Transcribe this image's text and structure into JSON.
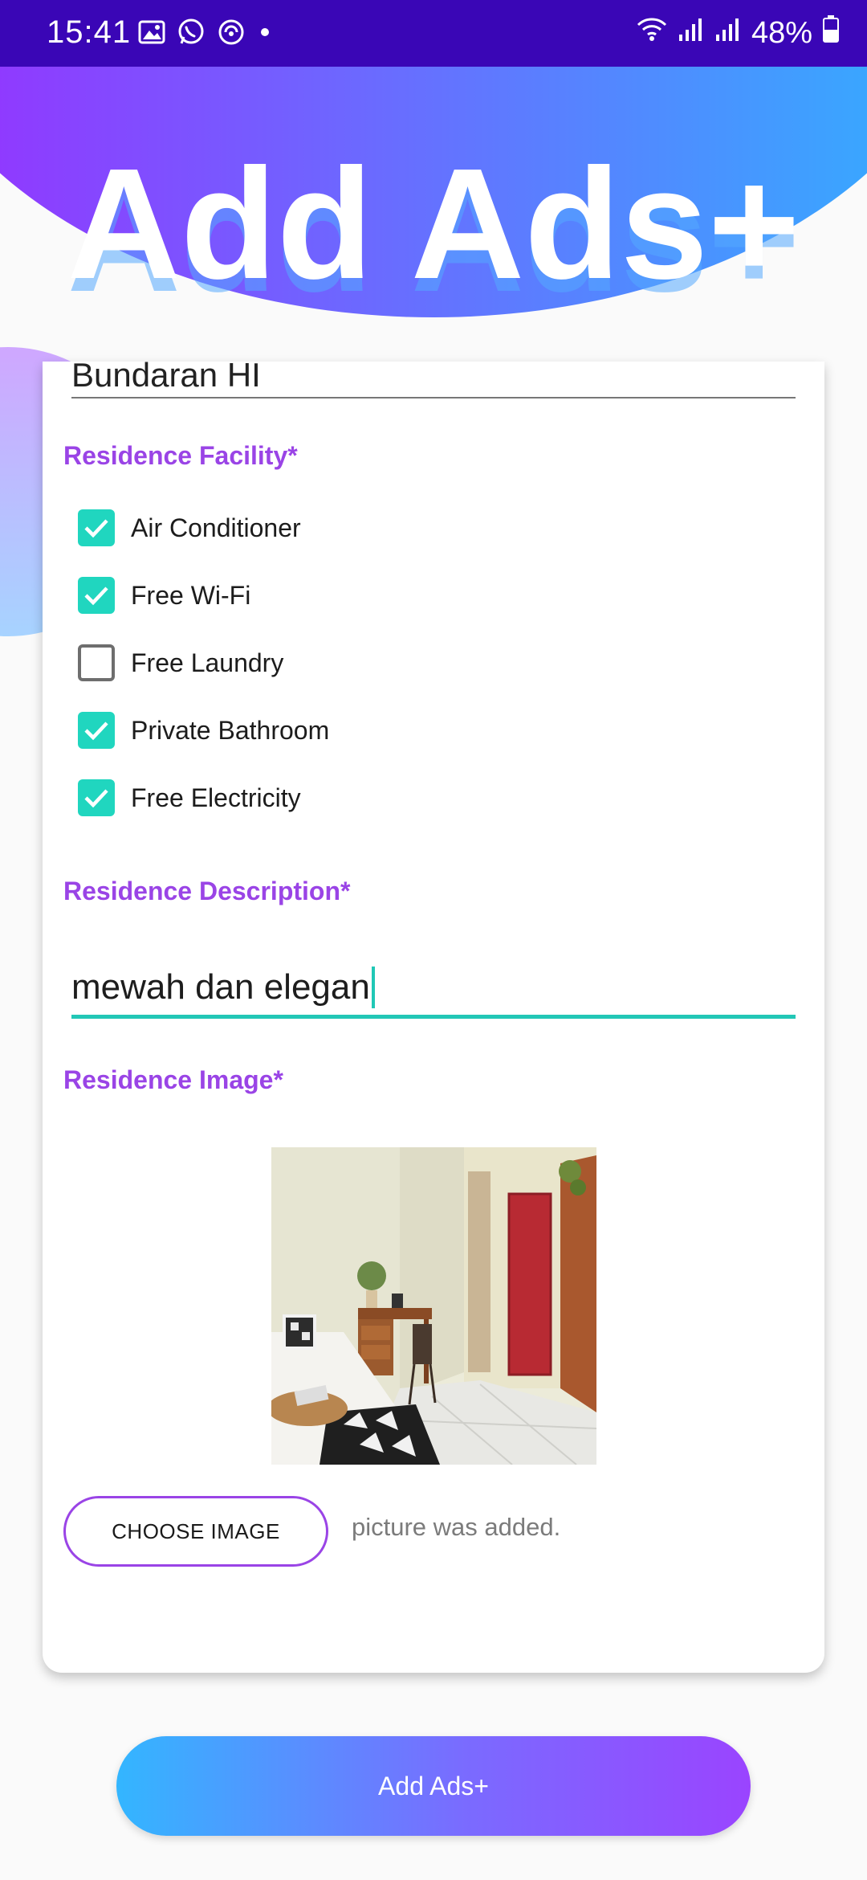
{
  "status_bar": {
    "time": "15:41",
    "battery": "48%",
    "left_icons": [
      "gallery-icon",
      "whatsapp-icon",
      "sync-icon",
      "dot-icon"
    ],
    "right_icons": [
      "wifi-icon",
      "signal-icon",
      "signal-icon",
      "battery-icon"
    ]
  },
  "header": {
    "title": "Add Ads+"
  },
  "form": {
    "previous_field_value": "Bundaran HI",
    "facility_label": "Residence Facility*",
    "facilities": [
      {
        "label": "Air Conditioner",
        "checked": true
      },
      {
        "label": "Free Wi-Fi",
        "checked": true
      },
      {
        "label": "Free Laundry",
        "checked": false
      },
      {
        "label": "Private Bathroom",
        "checked": true
      },
      {
        "label": "Free Electricity",
        "checked": true
      }
    ],
    "description_label": "Residence Description*",
    "description_value": "mewah dan elegan",
    "image_label": "Residence Image*",
    "choose_image_label": "CHOOSE IMAGE",
    "image_status": "picture was added."
  },
  "submit": {
    "label": "Add Ads+"
  },
  "colors": {
    "status_bar": "#3a06b6",
    "accent_purple": "#9a44e6",
    "check_teal": "#20d6bf",
    "gradient_start": "#9a2cff",
    "gradient_end": "#2fb3ff"
  }
}
